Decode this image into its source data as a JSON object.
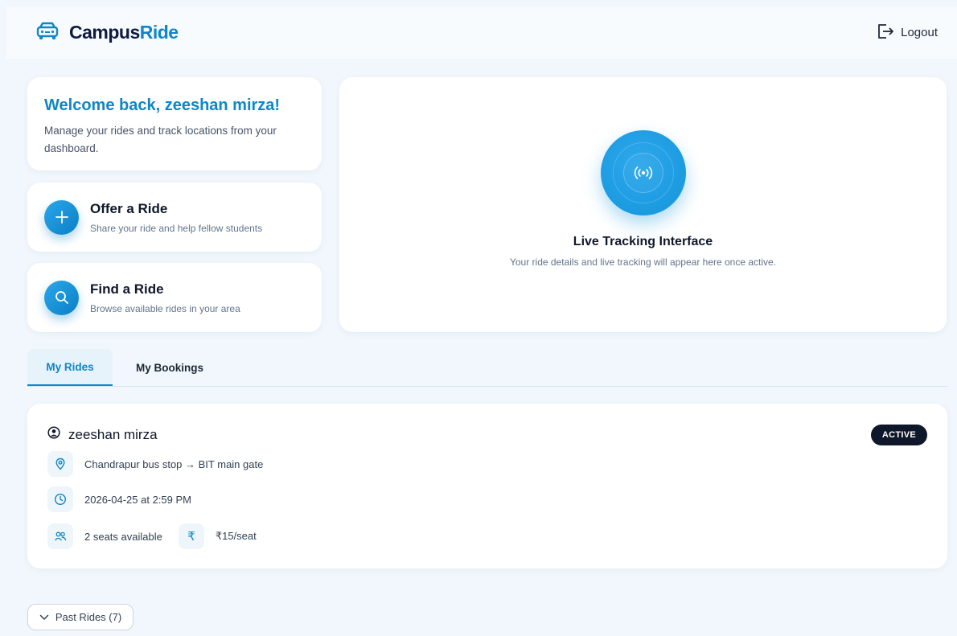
{
  "header": {
    "brand_part1": "Campus",
    "brand_part2": "Ride",
    "logout_label": "Logout"
  },
  "welcome": {
    "title": "Welcome back, zeeshan mirza!",
    "subtitle": "Manage your rides and track locations from your dashboard."
  },
  "actions": {
    "offer": {
      "title": "Offer a Ride",
      "subtitle": "Share your ride and help fellow students"
    },
    "find": {
      "title": "Find a Ride",
      "subtitle": "Browse available rides in your area"
    }
  },
  "tracking": {
    "title": "Live Tracking Interface",
    "subtitle": "Your ride details and live tracking will appear here once active."
  },
  "tabs": [
    {
      "label": "My Rides",
      "active": true
    },
    {
      "label": "My Bookings",
      "active": false
    }
  ],
  "ride": {
    "rider": "zeeshan mirza",
    "status": "ACTIVE",
    "route": "Chandrapur bus stop → BIT main gate",
    "datetime": "2026-04-25 at 2:59 PM",
    "seats": "2 seats available",
    "price": "₹15/seat",
    "price_icon": "₹"
  },
  "past_rides_label": "Past Rides (7)",
  "colors": {
    "accent": "#0f86c6",
    "brand_dark": "#0f1b3d",
    "background": "#f1f7fc",
    "badge": "#0f172a"
  },
  "icons": [
    "car-icon",
    "logout-icon",
    "plus-icon",
    "search-icon",
    "radio-signal-icon",
    "user-circle-icon",
    "map-pin-icon",
    "clock-icon",
    "users-icon",
    "rupee-icon",
    "chevron-down-icon"
  ]
}
